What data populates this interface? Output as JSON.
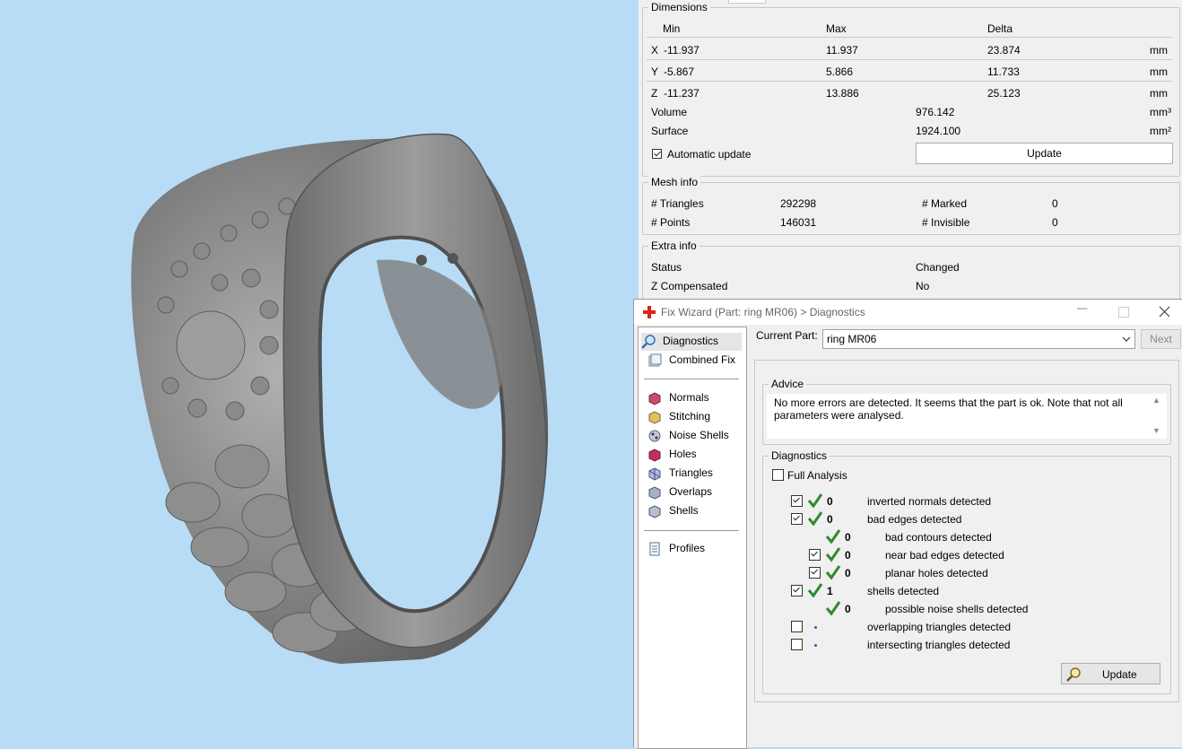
{
  "properties": {
    "dimensions": {
      "title": "Dimensions",
      "headers": [
        "Min",
        "Max",
        "Delta"
      ],
      "rows": [
        {
          "axis": "X",
          "min": "-11.937",
          "max": "11.937",
          "delta": "23.874",
          "unit": "mm"
        },
        {
          "axis": "Y",
          "min": "-5.867",
          "max": "5.866",
          "delta": "11.733",
          "unit": "mm"
        },
        {
          "axis": "Z",
          "min": "-11.237",
          "max": "13.886",
          "delta": "25.123",
          "unit": "mm"
        }
      ],
      "volume_label": "Volume",
      "volume_value": "976.142",
      "volume_unit": "mm³",
      "surface_label": "Surface",
      "surface_value": "1924.100",
      "surface_unit": "mm²",
      "auto_update_label": "Automatic update",
      "auto_update_checked": true,
      "update_button": "Update"
    },
    "mesh_info": {
      "title": "Mesh info",
      "triangles_label": "# Triangles",
      "triangles_value": "292298",
      "points_label": "# Points",
      "points_value": "146031",
      "marked_label": "# Marked",
      "marked_value": "0",
      "invisible_label": "# Invisible",
      "invisible_value": "0"
    },
    "extra_info": {
      "title": "Extra info",
      "status_label": "Status",
      "status_value": "Changed",
      "zcomp_label": "Z Compensated",
      "zcomp_value": "No"
    }
  },
  "wizard": {
    "title": "Fix Wizard (Part: ring MR06) > Diagnostics",
    "nav": {
      "top": [
        "Diagnostics",
        "Combined Fix"
      ],
      "tools": [
        "Normals",
        "Stitching",
        "Noise Shells",
        "Holes",
        "Triangles",
        "Overlaps",
        "Shells"
      ],
      "bottom": [
        "Profiles"
      ]
    },
    "current_part_label": "Current Part:",
    "current_part_value": "ring MR06",
    "next_button": "Next",
    "advice_title": "Advice",
    "advice_text": "No more errors are detected. It seems that the part is ok. Note that not all parameters were analysed.",
    "diagnostics_title": "Diagnostics",
    "full_analysis_label": "Full Analysis",
    "items": [
      {
        "count": "0",
        "label": "inverted normals detected"
      },
      {
        "count": "0",
        "label": "bad edges detected"
      },
      {
        "count": "0",
        "label": "bad contours detected"
      },
      {
        "count": "0",
        "label": "near bad edges detected"
      },
      {
        "count": "0",
        "label": "planar holes detected"
      },
      {
        "count": "1",
        "label": "shells detected"
      },
      {
        "count": "0",
        "label": "possible noise shells detected"
      },
      {
        "count": "",
        "label": "overlapping triangles detected"
      },
      {
        "count": "",
        "label": "intersecting triangles detected"
      }
    ],
    "update_button": "Update"
  },
  "colors": {
    "viewport_bg": "#b8dcf6",
    "model_gray": "#7a7a7a",
    "check_green": "#2e8b2e",
    "wizard_icon_red": "#d8261c"
  }
}
